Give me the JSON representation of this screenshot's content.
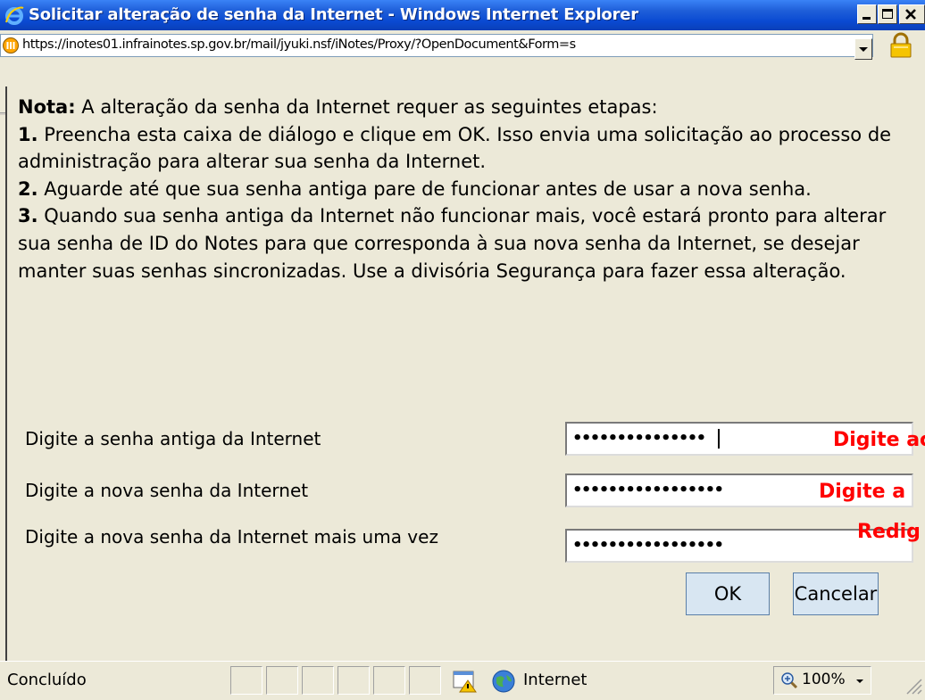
{
  "window": {
    "title": "Solicitar alteração de senha da Internet - Windows Internet Explorer"
  },
  "address": {
    "url": "https://inotes01.infrainotes.sp.gov.br/mail/jyuki.nsf/iNotes/Proxy/?OpenDocument&Form=s"
  },
  "note": {
    "intro_bold": "Nota:",
    "intro": " A alteração da senha da Internet requer as seguintes etapas:",
    "step1_num": "1.",
    "step1": " Preencha esta caixa de diálogo e clique em OK. Isso envia uma solicitação ao processo de administração para alterar sua senha da Internet.",
    "step2_num": "2.",
    "step2": " Aguarde até que sua senha antiga pare de funcionar antes de usar a nova senha.",
    "step3_num": "3.",
    "step3": " Quando sua senha antiga da Internet não funcionar mais, você estará pronto para alterar sua senha de ID do Notes para que corresponda à sua nova senha da Internet, se desejar manter suas senhas sincronizadas. Use a divisória Segurança para fazer essa alteração."
  },
  "form": {
    "old_label": "Digite a senha antiga da Internet",
    "old_value": "•••••••••••••••",
    "old_hint": "Digite ac",
    "new_label": "Digite a nova senha da Internet",
    "new_value": "•••••••••••••••••",
    "new_hint": "Digite a",
    "confirm_label": "Digite a nova senha da Internet mais uma vez",
    "confirm_value": "•••••••••••••••••",
    "confirm_hint": "Redig"
  },
  "buttons": {
    "ok": "OK",
    "cancel": "Cancelar"
  },
  "statusbar": {
    "status": "Concluído",
    "zone": "Internet",
    "zoom": "100%"
  },
  "colors": {
    "title_bar": "#0a4ad2",
    "hint_red": "#ff0000",
    "button_face": "#d8e6f2"
  }
}
